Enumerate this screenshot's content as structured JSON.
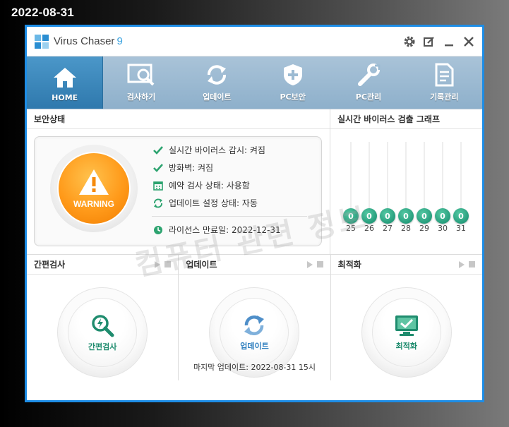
{
  "date_stamp": "2022-08-31",
  "window": {
    "app_name": "Virus Chaser",
    "app_version": "9",
    "controls": [
      "gear-icon",
      "edit-icon",
      "minimize-icon",
      "close-icon"
    ]
  },
  "nav": {
    "items": [
      {
        "label": "HOME",
        "icon": "home-icon",
        "active": true
      },
      {
        "label": "검사하기",
        "icon": "scan-icon",
        "active": false
      },
      {
        "label": "업데이트",
        "icon": "refresh-icon",
        "active": false
      },
      {
        "label": "PC보안",
        "icon": "shield-plus-icon",
        "active": false
      },
      {
        "label": "PC관리",
        "icon": "wrench-icon",
        "active": false
      },
      {
        "label": "기록관리",
        "icon": "document-icon",
        "active": false
      }
    ]
  },
  "security_status": {
    "title": "보안상태",
    "badge_label": "WARNING",
    "badge_color": "#ff9a1a",
    "items": [
      {
        "icon": "check-icon",
        "text": "실시간 바이러스 감시: 켜짐"
      },
      {
        "icon": "check-icon",
        "text": "방화벽: 켜짐"
      },
      {
        "icon": "calendar-icon",
        "text": "예약 검사 상태: 사용함"
      },
      {
        "icon": "refresh-icon",
        "text": "업데이트 설정 상태: 자동"
      }
    ],
    "license": {
      "icon": "clock-icon",
      "text": "라이선스 만료일: 2022-12-31"
    }
  },
  "watermark": "컴퓨터 관련 정보",
  "graph": {
    "title": "실시간 바이러스 검출 그래프",
    "accent": "#138a6b"
  },
  "chart_data": {
    "type": "bar",
    "categories": [
      "25",
      "26",
      "27",
      "28",
      "29",
      "30",
      "31"
    ],
    "values": [
      0,
      0,
      0,
      0,
      0,
      0,
      0
    ],
    "title": "실시간 바이러스 검출 그래프"
  },
  "quick_scan": {
    "title": "간편검사",
    "button_label": "간편검사"
  },
  "update": {
    "title": "업데이트",
    "button_label": "업데이트",
    "last_update": "마지막 업데이트: 2022-08-31 15시"
  },
  "optimize": {
    "title": "최적화",
    "button_label": "최적화"
  }
}
